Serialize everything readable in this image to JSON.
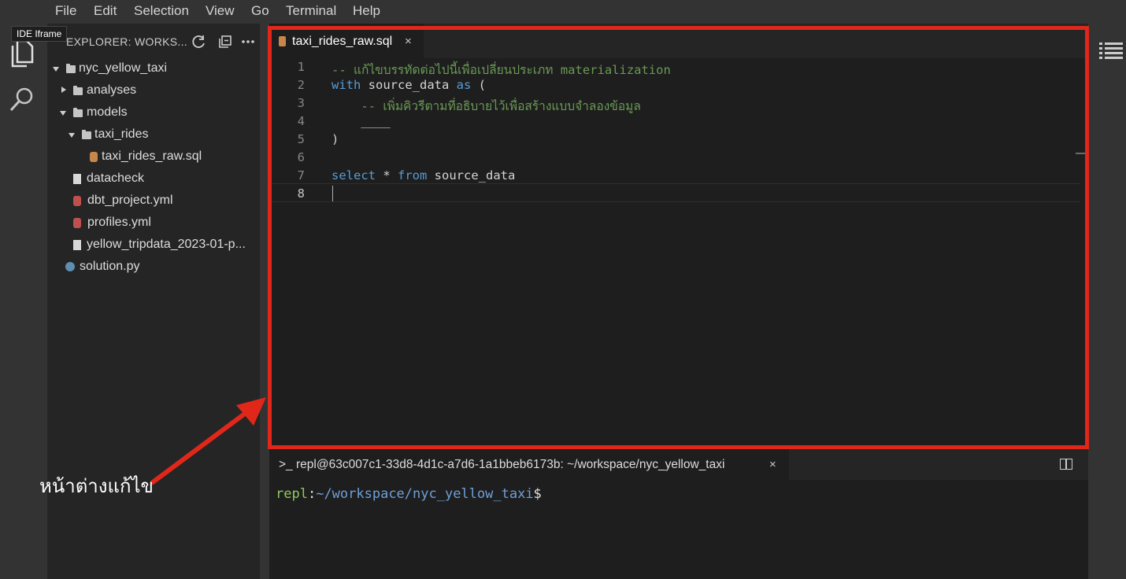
{
  "menubar": {
    "items": [
      "File",
      "Edit",
      "Selection",
      "View",
      "Go",
      "Terminal",
      "Help"
    ]
  },
  "tooltip": "IDE Iframe",
  "activity_bar": {
    "icons": [
      "files-icon",
      "search-icon"
    ]
  },
  "explorer": {
    "title": "EXPLORER: WORKS...",
    "tree": [
      {
        "label": "nyc_yellow_taxi",
        "type": "folder",
        "open": true
      },
      {
        "label": "analyses",
        "type": "folder",
        "open": false
      },
      {
        "label": "models",
        "type": "folder",
        "open": true
      },
      {
        "label": "taxi_rides",
        "type": "folder",
        "open": true
      },
      {
        "label": "taxi_rides_raw.sql",
        "type": "sql"
      },
      {
        "label": "datacheck",
        "type": "file"
      },
      {
        "label": "dbt_project.yml",
        "type": "yml"
      },
      {
        "label": "profiles.yml",
        "type": "yml"
      },
      {
        "label": "yellow_tripdata_2023-01-p...",
        "type": "file"
      },
      {
        "label": "solution.py",
        "type": "py"
      }
    ]
  },
  "editor": {
    "tab_label": "taxi_rides_raw.sql",
    "tab_close": "×",
    "line_numbers": [
      "1",
      "2",
      "3",
      "4",
      "5",
      "6",
      "7",
      "8"
    ],
    "active_line": "8",
    "code": {
      "l1": "-- แก้ไขบรรทัดต่อไปนี้เพื่อเปลี่ยนประเภท materialization",
      "l2_kw1": "with",
      "l2_mid": " source_data ",
      "l2_kw2": "as",
      "l2_end": " (",
      "l3": "    -- เพิ่มคิวรีตามที่อธิบายไว้เพื่อสร้างแบบจำลองข้อมูล",
      "l4": "    ____",
      "l5": ")",
      "l6": "",
      "l7_kw1": "select",
      "l7_mid": " * ",
      "l7_kw2": "from",
      "l7_end": " source_data",
      "l8": ""
    }
  },
  "terminal": {
    "tab_prefix": ">_",
    "tab_label": "repl@63c007c1-33d8-4d1c-a7d6-1a1bbeb6173b: ~/workspace/nyc_yellow_taxi",
    "tab_close": "×",
    "prompt_user": "repl",
    "prompt_sep": ":",
    "prompt_path": "~/workspace/nyc_yellow_taxi",
    "prompt_dollar": "$"
  },
  "annotation": {
    "text": "หน้าต่างแก้ไข",
    "color": "#e0271a"
  },
  "colors": {
    "accent_red": "#e0271a",
    "comment_green": "#6a9955",
    "keyword_blue": "#569cd6"
  }
}
